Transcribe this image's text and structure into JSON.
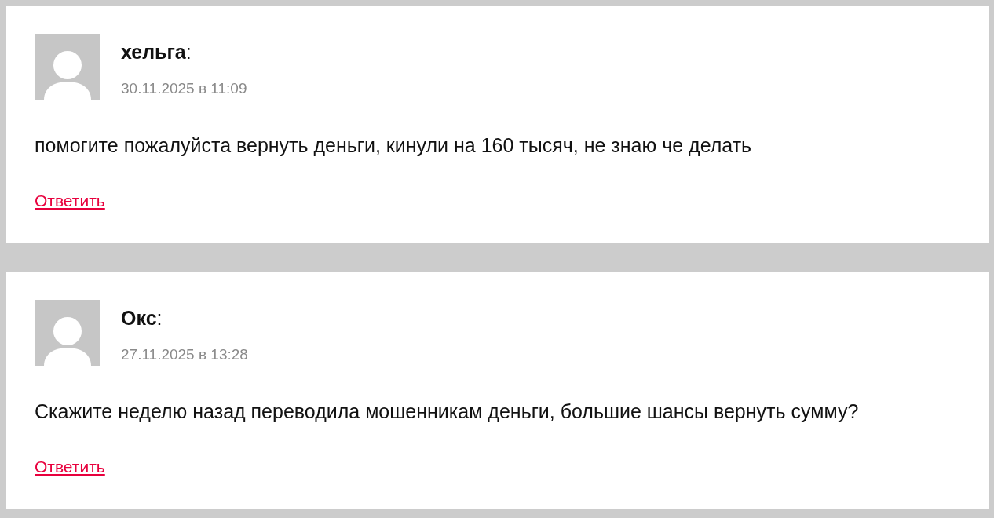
{
  "comments": [
    {
      "author": "**хельга**:",
      "date": "30.11.2025 в 11:09",
      "text": "помогите пожалуйста вернуть деньги, кинули на 160 тысяч, не знаю че делать",
      "reply_link": "Ответить"
    },
    {
      "author": "**Окс**:",
      "date": "27.11.2025 в 13:28",
      "text": "Скажите неделю назад переводила мошенникам деньги, большие шансы вернуть сумму?",
      "reply_link": "Ответить"
    }
  ]
}
